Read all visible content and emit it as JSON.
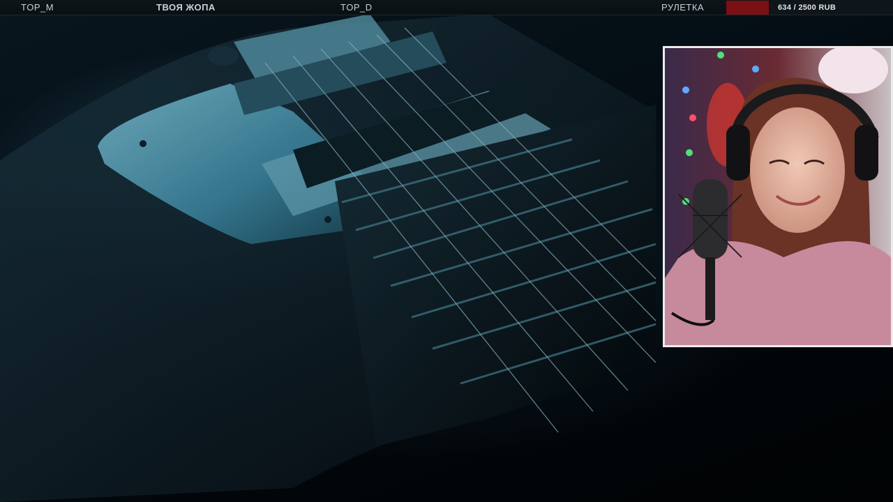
{
  "overlay": {
    "top_m_label": "TOP_M",
    "top_m_value": "ТВОЯ ЖОПА",
    "top_d_label": "TOP_D",
    "roulette_label": "РУЛЕТКА",
    "goal": {
      "current": 634,
      "target": 2500,
      "currency": "RUB",
      "text": "634 / 2500 RUB",
      "fill_color": "#7a0f14"
    }
  },
  "background": {
    "subject": "electric guitar close-up",
    "tint": "#2a7a9a"
  },
  "webcam": {
    "border_color": "#ececec",
    "subject": "streamer with headphones and microphone"
  }
}
